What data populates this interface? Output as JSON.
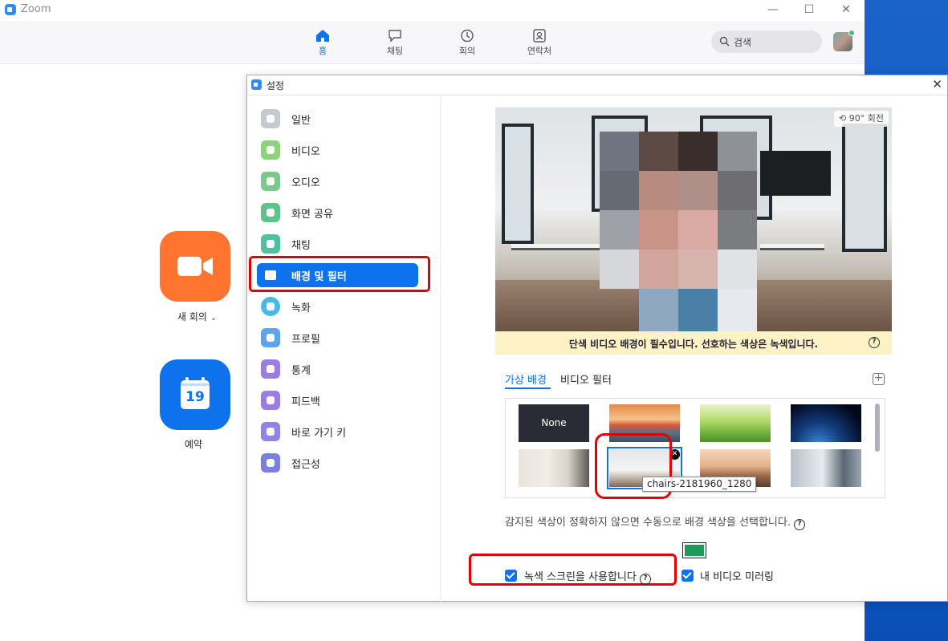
{
  "main_window": {
    "title": "Zoom",
    "controls": {
      "minimize": "—",
      "maximize": "☐",
      "close": "✕"
    },
    "nav": [
      {
        "label": "홈",
        "icon": "home-icon",
        "active": true
      },
      {
        "label": "채팅",
        "icon": "chat-icon",
        "active": false
      },
      {
        "label": "회의",
        "icon": "clock-icon",
        "active": false
      },
      {
        "label": "연락처",
        "icon": "contacts-icon",
        "active": false
      }
    ],
    "search_placeholder": "검색",
    "actions": {
      "new_meeting": "새 회의",
      "new_meeting_caret": "⌄",
      "schedule": "예약",
      "calendar_day": "19"
    }
  },
  "settings": {
    "title": "설정",
    "close_glyph": "✕",
    "sidebar": [
      {
        "label": "일반",
        "icon": "gear-icon",
        "color": "#c8c8cf"
      },
      {
        "label": "비디오",
        "icon": "video-icon",
        "color": "#8ed17f"
      },
      {
        "label": "오디오",
        "icon": "headphones-icon",
        "color": "#7cc88c"
      },
      {
        "label": "화면 공유",
        "icon": "share-screen-icon",
        "color": "#5cc38c"
      },
      {
        "label": "채팅",
        "icon": "chat-icon",
        "color": "#4fc0a0"
      },
      {
        "label": "배경 및 필터",
        "icon": "background-icon",
        "color": "#ffffff",
        "active": true
      },
      {
        "label": "녹화",
        "icon": "record-icon",
        "color": "#49b9e8"
      },
      {
        "label": "프로필",
        "icon": "profile-icon",
        "color": "#5ea3ee"
      },
      {
        "label": "통계",
        "icon": "statistics-icon",
        "color": "#9b7fe0"
      },
      {
        "label": "피드백",
        "icon": "feedback-icon",
        "color": "#9a7ce2"
      },
      {
        "label": "바로 가기 키",
        "icon": "keyboard-icon",
        "color": "#8d84e4"
      },
      {
        "label": "접근성",
        "icon": "accessibility-icon",
        "color": "#7a7fe0"
      }
    ],
    "preview": {
      "rotate_label": "90° 회전",
      "notice": "단색 비디오 배경이 필수입니다. 선호하는 색상은 녹색입니다."
    },
    "tabs": [
      {
        "label": "가상 배경",
        "active": true
      },
      {
        "label": "비디오 필터",
        "active": false
      }
    ],
    "gallery": {
      "none_label": "None",
      "tooltip": "chairs-2181960_1280"
    },
    "manual_color_hint": "감지된 색상이 정확하지 않으면 수동으로 배경 색상을 선택합니다.",
    "selected_color": "#1e9a58",
    "green_screen": {
      "label": "녹색 스크린을 사용합니다",
      "checked": true
    },
    "mirror_video": {
      "label": "내 비디오 미러링",
      "checked": true
    }
  },
  "colors": {
    "accent": "#0e72ed",
    "highlight_red": "#e20000",
    "new_meeting": "#ff742e",
    "schedule": "#0e72ed"
  }
}
